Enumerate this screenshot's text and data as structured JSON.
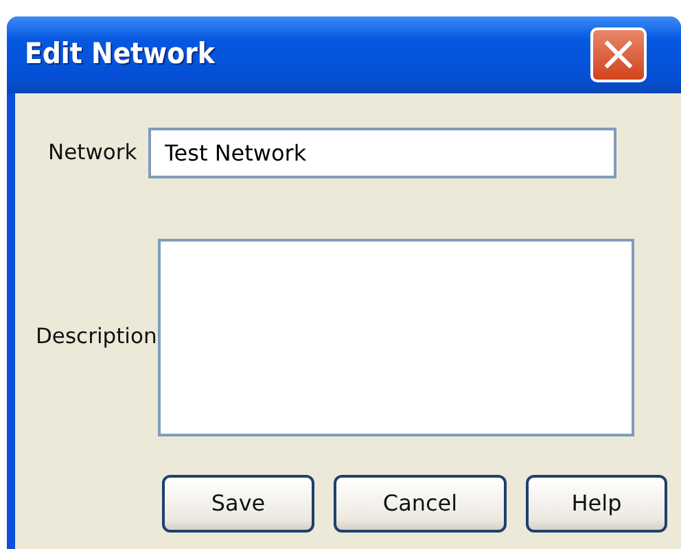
{
  "window": {
    "title": "Edit Network",
    "close": "×"
  },
  "fields": [
    {
      "kind": "input",
      "label": "Network",
      "value": "Test Network"
    },
    {
      "kind": "textarea",
      "label": "Description"
    }
  ],
  "buttons": [
    "Save",
    "Cancel",
    "Help"
  ]
}
